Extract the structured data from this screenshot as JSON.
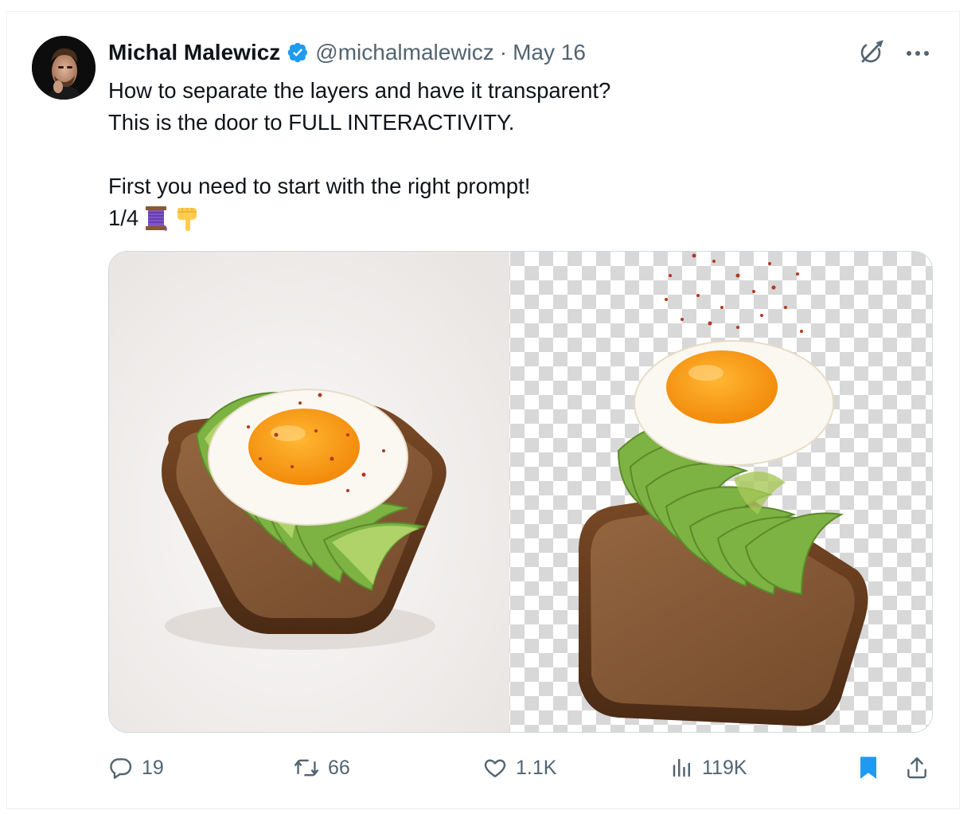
{
  "tweet": {
    "author_name": "Michal Malewicz",
    "handle": "@michalmalewicz",
    "separator": "·",
    "date": "May 16",
    "lines": [
      "How to separate the layers and have it transparent?",
      "This is the door to FULL INTERACTIVITY.",
      "First you need to start with the right prompt!",
      "1/4"
    ],
    "emojis": [
      "thread-emoji",
      "pointing-down-emoji"
    ]
  },
  "icons": {
    "verified": "verified-badge-icon",
    "grok": "grok-icon",
    "more": "more-icon",
    "reply": "reply-icon",
    "retweet": "retweet-icon",
    "like": "like-icon",
    "views": "views-icon",
    "bookmark": "bookmark-icon",
    "share": "share-icon"
  },
  "stats": {
    "replies": "19",
    "retweets": "66",
    "likes": "1.1K",
    "views": "119K"
  },
  "colors": {
    "verified": "#1d9bf0",
    "bookmark": "#1d9bf0",
    "secondary_text": "#536471",
    "text": "#0f1419",
    "border": "#cfd9de"
  }
}
